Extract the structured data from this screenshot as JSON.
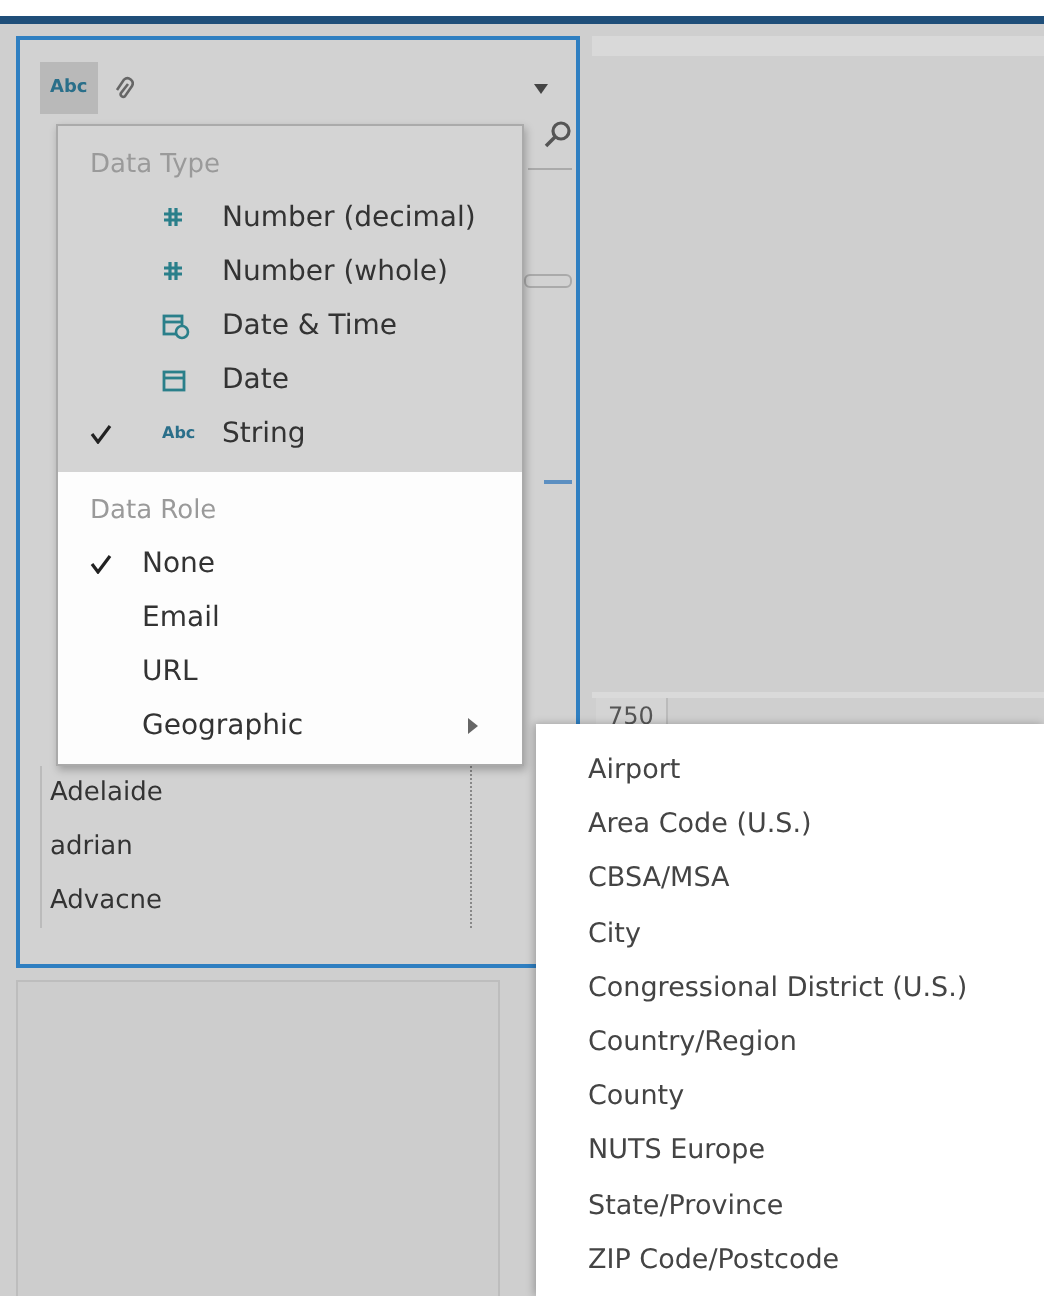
{
  "field_header": {
    "type_badge": "Abc"
  },
  "type_menu": {
    "title": "Data Type",
    "items": [
      {
        "label": "Number (decimal)",
        "kind": "hash",
        "selected": false
      },
      {
        "label": "Number (whole)",
        "kind": "hash",
        "selected": false
      },
      {
        "label": "Date & Time",
        "kind": "datetime",
        "selected": false
      },
      {
        "label": "Date",
        "kind": "date",
        "selected": false
      },
      {
        "label": "String",
        "kind": "text",
        "badge": "Abc",
        "selected": true
      }
    ]
  },
  "role_menu": {
    "title": "Data Role",
    "items": [
      {
        "label": "None",
        "selected": true,
        "has_submenu": false
      },
      {
        "label": "Email",
        "selected": false,
        "has_submenu": false
      },
      {
        "label": "URL",
        "selected": false,
        "has_submenu": false
      },
      {
        "label": "Geographic",
        "selected": false,
        "has_submenu": true
      }
    ]
  },
  "geographic_submenu": {
    "items": [
      "Airport",
      "Area Code (U.S.)",
      "CBSA/MSA",
      "City",
      "Congressional District (U.S.)",
      "Country/Region",
      "County",
      "NUTS Europe",
      "State/Province",
      "ZIP Code/Postcode"
    ]
  },
  "values": [
    "Adelaide",
    "adrian",
    "Advacne"
  ],
  "column_2_header": "750"
}
